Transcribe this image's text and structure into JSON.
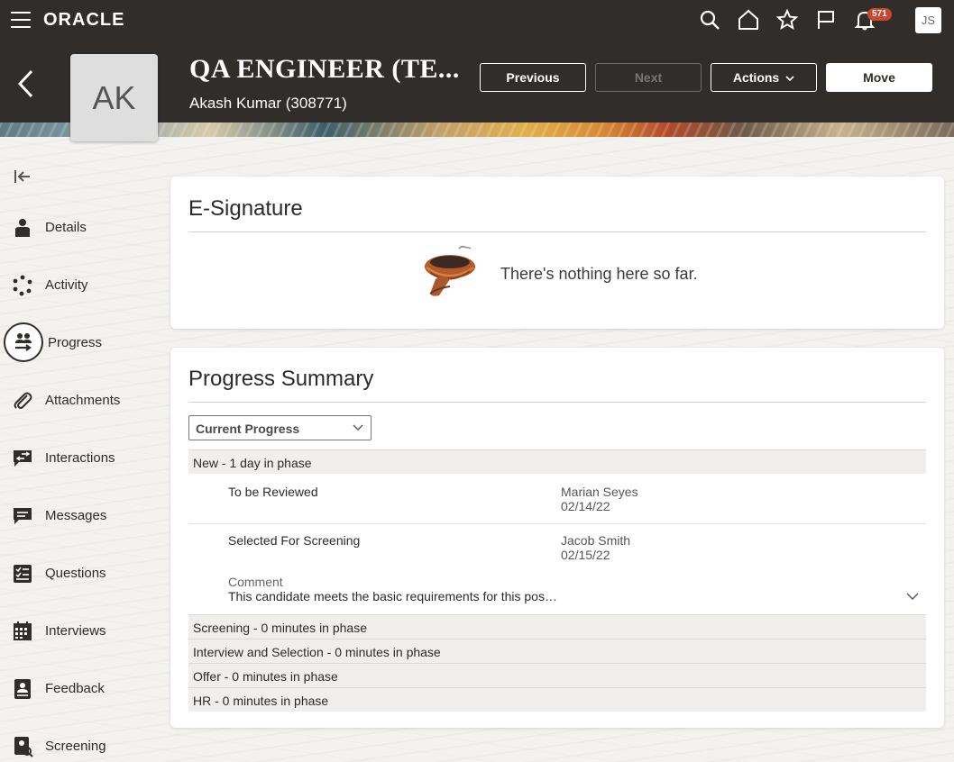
{
  "header": {
    "brand": "ORACLE",
    "notification_count": "571",
    "user_initials": "JS",
    "job_title": "QA ENGINEER (TE...",
    "candidate_initials": "AK",
    "candidate_name": "Akash Kumar (308771)",
    "buttons": {
      "previous": "Previous",
      "next": "Next",
      "actions": "Actions",
      "move": "Move"
    },
    "icons": [
      "menu-icon",
      "search-icon",
      "home-icon",
      "star-icon",
      "flag-icon",
      "bell-icon",
      "back-icon"
    ]
  },
  "sidebar": {
    "items": [
      {
        "label": "Details",
        "icon": "person-icon"
      },
      {
        "label": "Activity",
        "icon": "activity-icon"
      },
      {
        "label": "Progress",
        "icon": "progress-icon",
        "active": true
      },
      {
        "label": "Attachments",
        "icon": "paperclip-icon"
      },
      {
        "label": "Interactions",
        "icon": "interactions-icon"
      },
      {
        "label": "Messages",
        "icon": "message-icon"
      },
      {
        "label": "Questions",
        "icon": "checklist-icon"
      },
      {
        "label": "Interviews",
        "icon": "calendar-icon"
      },
      {
        "label": "Feedback",
        "icon": "feedback-icon"
      },
      {
        "label": "Screening",
        "icon": "screening-icon"
      }
    ]
  },
  "esignature": {
    "title": "E-Signature",
    "empty_message": "There's nothing here so far."
  },
  "progress": {
    "title": "Progress Summary",
    "view_select": "Current Progress",
    "current_phase": "New - 1 day in phase",
    "steps": [
      {
        "name": "To be Reviewed",
        "person": "Marian Seyes",
        "date": "02/14/22"
      },
      {
        "name": "Selected For Screening",
        "person": "Jacob Smith",
        "date": "02/15/22"
      }
    ],
    "comment_label": "Comment",
    "comment_text": "This candidate meets the basic requirements for this pos…",
    "other_phases": [
      "Screening - 0 minutes in phase",
      "Interview and Selection - 0 minutes in phase",
      "Offer - 0 minutes in phase",
      "HR - 0 minutes in phase"
    ]
  },
  "colors": {
    "header_bg": "#312d2a",
    "badge": "#c74634",
    "page_bg": "#f4f2ef"
  }
}
